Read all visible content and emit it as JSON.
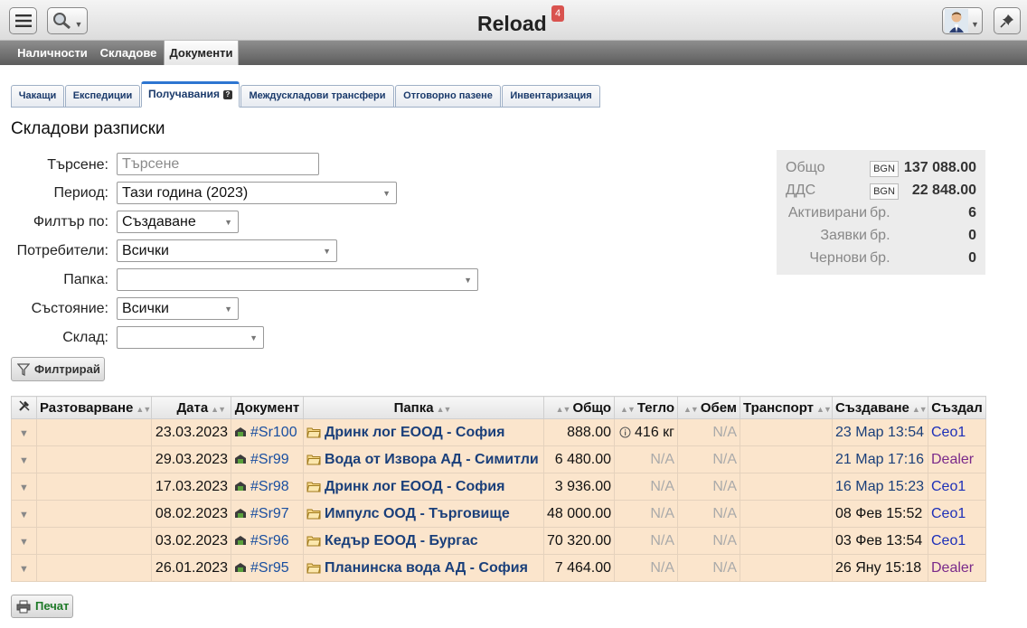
{
  "app": {
    "title": "Reload",
    "badge": "4"
  },
  "nav": {
    "tabs": [
      "Наличности",
      "Складове",
      "Документи"
    ]
  },
  "subtabs": [
    "Чакащи",
    "Експедиции",
    "Получавания",
    "Междускладови трансфери",
    "Отговорно пазене",
    "Инвентаризация"
  ],
  "page_title": "Складови разписки",
  "form": {
    "search_label": "Търсене:",
    "search_placeholder": "Търсене",
    "period_label": "Период:",
    "period_value": "Тази година (2023)",
    "filter_by_label": "Филтър по:",
    "filter_by_value": "Създаване",
    "users_label": "Потребители:",
    "users_value": "Всички",
    "folder_label": "Папка:",
    "folder_value": "",
    "state_label": "Състояние:",
    "state_value": "Всички",
    "warehouse_label": "Склад:",
    "warehouse_value": "",
    "filter_button": "Филтрирай"
  },
  "summary": {
    "total_label": "Общо",
    "total_currency": "BGN",
    "total_value": "137 088.00",
    "vat_label": "ДДС",
    "vat_currency": "BGN",
    "vat_value": "22 848.00",
    "active_label": "Активирани",
    "active_unit": "бр.",
    "active_value": "6",
    "requests_label": "Заявки",
    "requests_unit": "бр.",
    "requests_value": "0",
    "drafts_label": "Чернови",
    "drafts_unit": "бр.",
    "drafts_value": "0"
  },
  "table": {
    "headers": [
      "Разтоварване",
      "Дата",
      "Документ",
      "Папка",
      "Общо",
      "Тегло",
      "Обем",
      "Транспорт",
      "Създаване",
      "Създал"
    ],
    "rows": [
      {
        "date": "23.03.2023",
        "doc": "#Sr100",
        "folder": "Дринк лог ЕООД - София",
        "total": "888.00",
        "weight": "416 кг",
        "volume": "N/A",
        "created": "23 Мар 13:54",
        "by": "Ceo1"
      },
      {
        "date": "29.03.2023",
        "doc": "#Sr99",
        "folder": "Вода от Извора АД - Симитли",
        "total": "6 480.00",
        "weight": "N/A",
        "volume": "N/A",
        "created": "21 Мар 17:16",
        "by": "Dealer"
      },
      {
        "date": "17.03.2023",
        "doc": "#Sr98",
        "folder": "Дринк лог ЕООД - София",
        "total": "3 936.00",
        "weight": "N/A",
        "volume": "N/A",
        "created": "16 Мар 15:23",
        "by": "Ceo1"
      },
      {
        "date": "08.02.2023",
        "doc": "#Sr97",
        "folder": "Импулс ООД - Търговище",
        "total": "48 000.00",
        "weight": "N/A",
        "volume": "N/A",
        "created": "08 Фев 15:52",
        "by": "Ceo1"
      },
      {
        "date": "03.02.2023",
        "doc": "#Sr96",
        "folder": "Кедър ЕООД - Бургас",
        "total": "70 320.00",
        "weight": "N/A",
        "volume": "N/A",
        "created": "03 Фев 13:54",
        "by": "Ceo1"
      },
      {
        "date": "26.01.2023",
        "doc": "#Sr95",
        "folder": "Планинска вода АД - София",
        "total": "7 464.00",
        "weight": "N/A",
        "volume": "N/A",
        "created": "26 Яну 15:18",
        "by": "Dealer"
      }
    ]
  },
  "print_button": "Печат"
}
